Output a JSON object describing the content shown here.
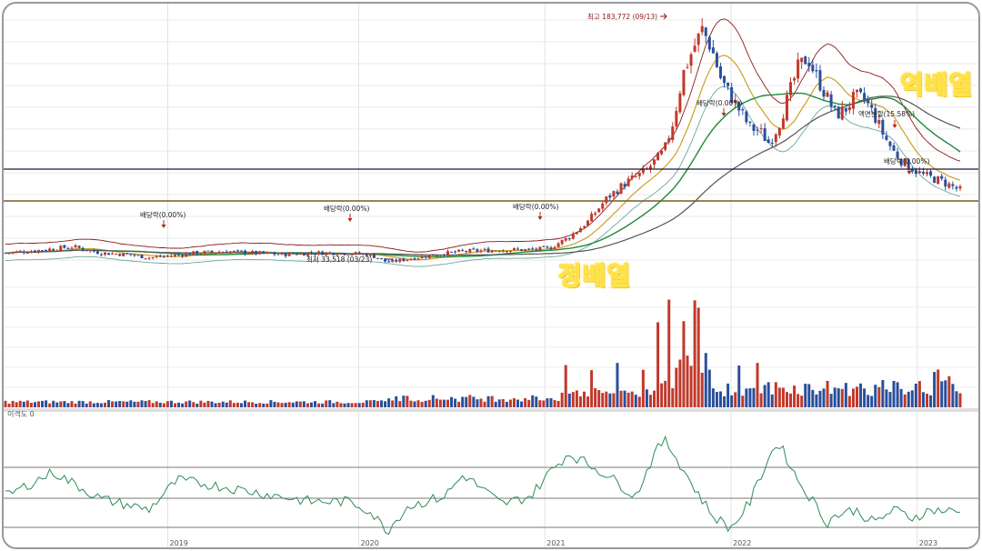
{
  "chart_data": {
    "type": "candlestick",
    "x_ticks": [
      "2019",
      "2020",
      "2021",
      "2022",
      "2023"
    ],
    "annotations": {
      "high": "최고 183,772 (09/13)",
      "low": "최저 33,518 (03/23)",
      "dividends": [
        "배당락(0.00%)",
        "배당락(0.00%)",
        "배당락(0.00%)",
        "배당락(0.00%)",
        "배당락(0.00%)"
      ],
      "split": "액면분할(15.58%)"
    },
    "oscillator_label": "이격도 0",
    "overlay_labels": {
      "reverse": "역배열",
      "forward": "정배열"
    },
    "colors": {
      "up": "#c0392b",
      "down": "#2a4f9a",
      "ma5": "#8b1a1a",
      "ma20": "#c9a227",
      "ma60": "#1e8a3a",
      "ma120": "#555555",
      "band": "#6aa8a0",
      "osc": "#2e8b57"
    },
    "price_path": [
      [
        0,
        40
      ],
      [
        0.04,
        42
      ],
      [
        0.07,
        44
      ],
      [
        0.1,
        40
      ],
      [
        0.13,
        39
      ],
      [
        0.15,
        37
      ],
      [
        0.17,
        38
      ],
      [
        0.2,
        40
      ],
      [
        0.23,
        41
      ],
      [
        0.26,
        40
      ],
      [
        0.29,
        39
      ],
      [
        0.32,
        40
      ],
      [
        0.35,
        40
      ],
      [
        0.38,
        39
      ],
      [
        0.39,
        37
      ],
      [
        0.4,
        34
      ],
      [
        0.42,
        36
      ],
      [
        0.45,
        39
      ],
      [
        0.48,
        41
      ],
      [
        0.52,
        42
      ],
      [
        0.55,
        42
      ],
      [
        0.57,
        43
      ],
      [
        0.59,
        50
      ],
      [
        0.61,
        60
      ],
      [
        0.63,
        75
      ],
      [
        0.65,
        85
      ],
      [
        0.67,
        92
      ],
      [
        0.69,
        105
      ],
      [
        0.7,
        125
      ],
      [
        0.71,
        155
      ],
      [
        0.72,
        170
      ],
      [
        0.73,
        183
      ],
      [
        0.74,
        170
      ],
      [
        0.75,
        150
      ],
      [
        0.76,
        140
      ],
      [
        0.77,
        130
      ],
      [
        0.78,
        120
      ],
      [
        0.79,
        118
      ],
      [
        0.8,
        110
      ],
      [
        0.81,
        122
      ],
      [
        0.82,
        140
      ],
      [
        0.83,
        158
      ],
      [
        0.84,
        165
      ],
      [
        0.85,
        152
      ],
      [
        0.86,
        140
      ],
      [
        0.87,
        128
      ],
      [
        0.88,
        132
      ],
      [
        0.89,
        140
      ],
      [
        0.9,
        138
      ],
      [
        0.91,
        128
      ],
      [
        0.92,
        115
      ],
      [
        0.93,
        105
      ],
      [
        0.94,
        98
      ],
      [
        0.95,
        94
      ],
      [
        0.96,
        90
      ],
      [
        0.97,
        88
      ],
      [
        0.98,
        86
      ],
      [
        1.0,
        80
      ]
    ],
    "oscillator_path": [
      [
        0,
        100
      ],
      [
        0.05,
        118
      ],
      [
        0.07,
        110
      ],
      [
        0.1,
        98
      ],
      [
        0.15,
        90
      ],
      [
        0.18,
        112
      ],
      [
        0.22,
        108
      ],
      [
        0.27,
        102
      ],
      [
        0.32,
        96
      ],
      [
        0.36,
        96
      ],
      [
        0.38,
        90
      ],
      [
        0.4,
        74
      ],
      [
        0.42,
        92
      ],
      [
        0.46,
        100
      ],
      [
        0.48,
        116
      ],
      [
        0.52,
        94
      ],
      [
        0.55,
        100
      ],
      [
        0.57,
        118
      ],
      [
        0.59,
        132
      ],
      [
        0.61,
        124
      ],
      [
        0.63,
        116
      ],
      [
        0.66,
        100
      ],
      [
        0.68,
        132
      ],
      [
        0.69,
        142
      ],
      [
        0.7,
        132
      ],
      [
        0.72,
        108
      ],
      [
        0.74,
        86
      ],
      [
        0.76,
        76
      ],
      [
        0.78,
        96
      ],
      [
        0.8,
        130
      ],
      [
        0.81,
        140
      ],
      [
        0.83,
        112
      ],
      [
        0.85,
        92
      ],
      [
        0.86,
        80
      ],
      [
        0.87,
        86
      ],
      [
        0.89,
        90
      ],
      [
        0.91,
        80
      ],
      [
        0.93,
        90
      ],
      [
        0.95,
        84
      ],
      [
        0.97,
        90
      ],
      [
        1.0,
        88
      ]
    ]
  }
}
